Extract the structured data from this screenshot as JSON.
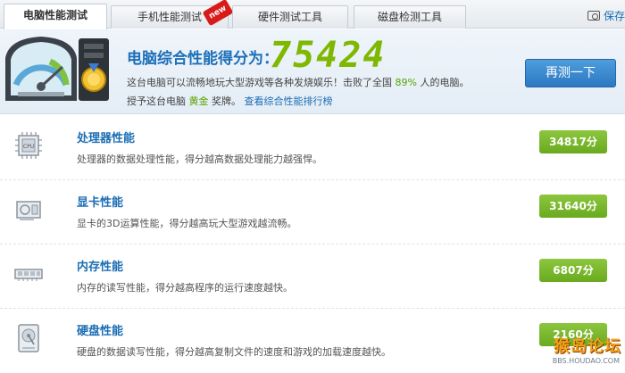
{
  "tabs": [
    {
      "label": "电脑性能测试",
      "active": true
    },
    {
      "label": "手机性能测试",
      "badge": "new"
    },
    {
      "label": "硬件测试工具"
    },
    {
      "label": "磁盘检测工具"
    }
  ],
  "toolbar": {
    "save_label": "保存"
  },
  "summary": {
    "title": "电脑综合性能得分为：",
    "score": "75424",
    "line1_prefix": "这台电脑可以流畅地玩大型游戏等各种发烧娱乐！击败了全国",
    "percent": "89%",
    "line1_suffix": "人的电脑。",
    "line2_prefix": "授予这台电脑",
    "medal": "黄金",
    "line2_suffix": "奖牌。",
    "rank_link": "查看综合性能排行榜",
    "retest_label": "再测一下"
  },
  "rows": [
    {
      "title": "处理器性能",
      "desc": "处理器的数据处理性能，得分越高数据处理能力越强悍。",
      "score": "34817分",
      "icon": "cpu-icon"
    },
    {
      "title": "显卡性能",
      "desc": "显卡的3D运算性能，得分越高玩大型游戏越流畅。",
      "score": "31640分",
      "icon": "graphics-card-icon"
    },
    {
      "title": "内存性能",
      "desc": "内存的读写性能，得分越高程序的运行速度越快。",
      "score": "6807分",
      "icon": "memory-icon"
    },
    {
      "title": "硬盘性能",
      "desc": "硬盘的数据读写性能，得分越高复制文件的速度和游戏的加载速度越快。",
      "score": "2160分",
      "icon": "hard-disk-icon"
    }
  ],
  "watermark": {
    "main": "猴岛论坛",
    "url": "BBS.HOUDAO.COM"
  },
  "colors": {
    "accent_blue": "#1b6db3",
    "score_green": "#7fb800",
    "badge_green": "#6aaa1e",
    "new_red": "#d71b1b"
  }
}
